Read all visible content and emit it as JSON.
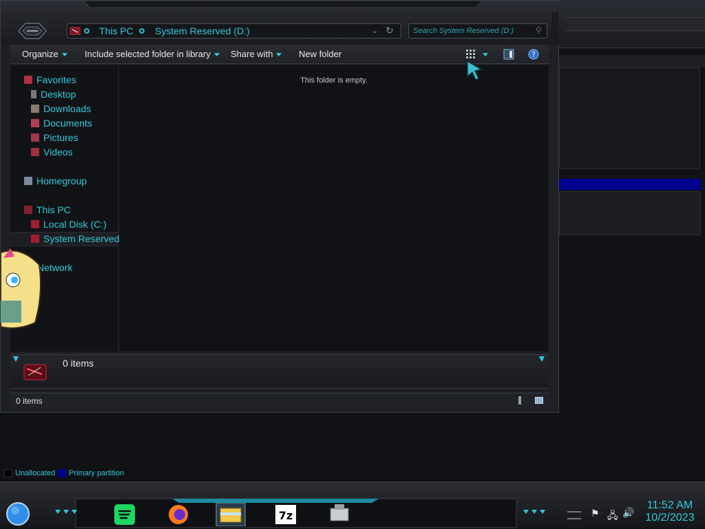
{
  "address": {
    "crumbs": [
      "This PC",
      "System Reserved (D:)"
    ]
  },
  "search": {
    "placeholder": "Search System Reserved (D:)"
  },
  "toolbar": {
    "organize": "Organize",
    "include": "Include selected folder in library",
    "share": "Share with",
    "new_folder": "New folder"
  },
  "nav": {
    "favorites": "Favorites",
    "desktop": "Desktop",
    "downloads": "Downloads",
    "documents": "Documents",
    "pictures": "Pictures",
    "videos": "Videos",
    "homegroup": "Homegroup",
    "this_pc": "This PC",
    "local_disk": "Local Disk (C:)",
    "system_reserved": "System Reserved",
    "network": "Network"
  },
  "content": {
    "empty_message": "This folder is empty."
  },
  "details": {
    "items": "0 items"
  },
  "status": {
    "items": "0 items"
  },
  "legend": {
    "unallocated": "Unallocated",
    "primary": "Primary partition"
  },
  "clock": {
    "time": "11:52 AM",
    "date": "10/2/2023"
  },
  "colors": {
    "accent": "#35c9d8",
    "selected_partition": "#00008f"
  }
}
